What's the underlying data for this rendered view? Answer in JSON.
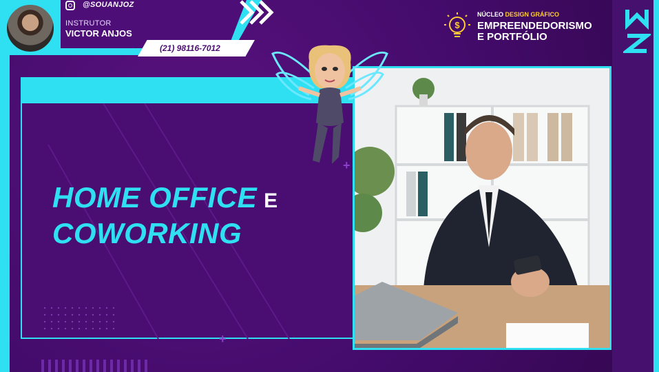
{
  "header": {
    "social_handle": "@SOUANJOZ",
    "instructor_label": "INSTRUTOR",
    "instructor_name": "VICTOR ANJOS",
    "phone": "(21) 98116-7012"
  },
  "brand": {
    "top_prefix": "NÚCLEO",
    "top_highlight": "DESIGN GRÁFICO",
    "line1": "EMPREENDEDORISMO",
    "line2": "E PORTFÓLIO"
  },
  "slide": {
    "title_part1": "HOME OFFICE",
    "title_conjunction": "E",
    "title_part2": "COWORKING"
  },
  "colors": {
    "accent_cyan": "#2fe0f2",
    "purple_dark": "#3d0a63",
    "highlight_yellow": "#ffcc33"
  },
  "icons": [
    "instagram-icon",
    "lightbulb-dollar-icon",
    "chevrons-right-icon",
    "logo-mark"
  ]
}
